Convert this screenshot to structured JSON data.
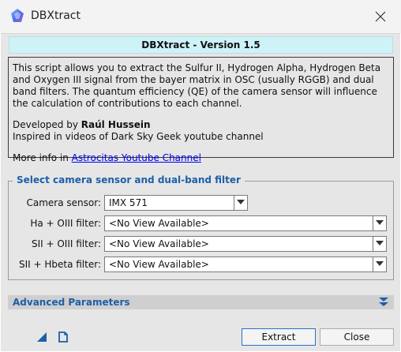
{
  "window": {
    "title": "DBXtract",
    "close_icon": "close-icon"
  },
  "banner": {
    "version_text": "DBXtract - Version 1.5"
  },
  "info": {
    "description": "This script allows you to extract the Sulfur II, Hydrogen Alpha, Hydrogen Beta and Oxygen III signal from the bayer matrix in OSC (usually RGGB) and dual band filters. The quantum efficiency (QE) of the camera sensor will influence the calculation of contributions to each channel.",
    "developed_by_prefix": "Developed by ",
    "developer_name": "Raúl Hussein",
    "inspired_text": "Inspired in videos of Dark Sky Geek youtube channel",
    "more_info_prefix": "More info in ",
    "link_text": "Astrocitas Youtube Channel"
  },
  "sensor_section": {
    "title": "Select camera sensor and dual-band filter",
    "rows": [
      {
        "label": "Camera sensor:",
        "value": "IMX 571"
      },
      {
        "label": "Ha + OIII filter:",
        "value": "<No View Available>"
      },
      {
        "label": "SII + OIII filter:",
        "value": "<No View Available>"
      },
      {
        "label": "SII + Hbeta filter:",
        "value": "<No View Available>"
      }
    ]
  },
  "advanced": {
    "title": "Advanced Parameters",
    "icon": "double-chevron-down-icon"
  },
  "footer": {
    "icons": [
      "new-instance-icon",
      "document-icon"
    ],
    "extract_label": "Extract",
    "close_label": "Close"
  },
  "colors": {
    "banner_bg": "#cdf3f8",
    "accent": "#1c5fa9",
    "link": "#0000ee",
    "dialog_bg": "#e6e6e6"
  }
}
